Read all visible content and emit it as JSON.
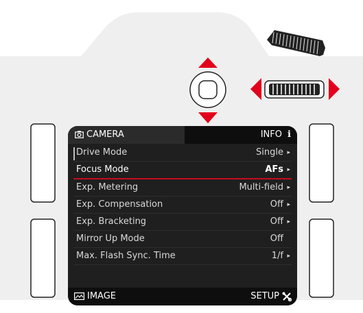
{
  "screen": {
    "tab_camera": "CAMERA",
    "tab_info": "INFO",
    "tab_info_icon": "i",
    "menu_items": [
      {
        "label": "Drive Mode",
        "value": "Single",
        "arrow": "▸"
      },
      {
        "label": "Focus Mode",
        "value": "AFs",
        "arrow": "▸",
        "selected": true
      },
      {
        "label": "Exp. Metering",
        "value": "Multi-field",
        "arrow": "▸"
      },
      {
        "label": "Exp. Compensation",
        "value": "Off",
        "arrow": "▸"
      },
      {
        "label": "Exp. Bracketing",
        "value": "Off",
        "arrow": "▸"
      },
      {
        "label": "Mirror Up Mode",
        "value": "Off",
        "arrow": ""
      },
      {
        "label": "Max. Flash Sync. Time",
        "value": "1/f",
        "arrow": "▸"
      }
    ],
    "bottom_left_label": "IMAGE",
    "bottom_right_label": "SETUP"
  },
  "colors": {
    "body": "#efefef",
    "screen": "#1f1f1f",
    "accent_red": "#e2001a",
    "selection_line": "#cc0a1e"
  },
  "icons": {
    "tab_camera": "camera-icon",
    "bottom_left": "image-icon",
    "bottom_right": "setup-tools-icon",
    "dpad_up": "triangle-up-icon",
    "dpad_down": "triangle-down-icon",
    "wheel_left": "triangle-left-icon",
    "wheel_right": "triangle-right-icon"
  }
}
